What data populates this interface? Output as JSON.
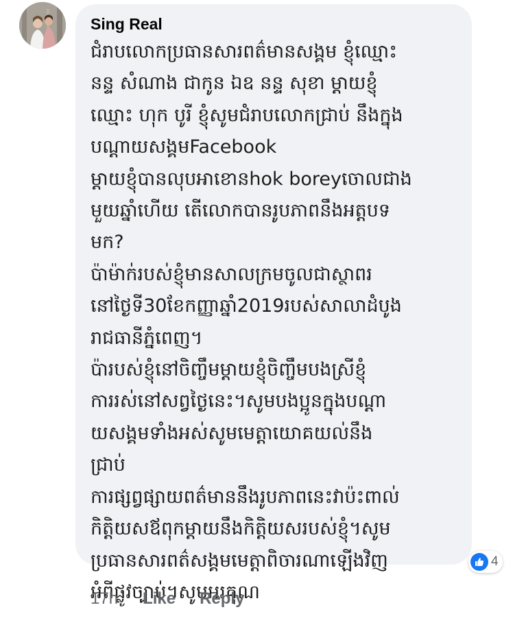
{
  "comment": {
    "author": "Sing Real",
    "lines": [
      "ជំរាបលោកប្រធានសារពត៌មានសង្គម ខ្ញុំឈ្មោះ",
      "នន្ទ សំណាង ជាកូន ឯឧ នន្ទ សុខា ម្តាយខ្ញុំ",
      "ឈ្មោះ ហុក បូរី ខ្ញុំសូមជំរាបលោកជ្រាប់ នឹងក្នុង",
      "បណ្តាយសង្គមFacebook",
      "ម្តាយខ្ញុំបានលុបអាខោនhok boreyចោលជាង",
      "មួយឆ្នាំហើយ តើលោកបានរូបភាពនឹងអត្តបទ",
      "មក?",
      "ប៉ាម៉ាក់របស់ខ្ញុំមានសាលក្រមចូលជាស្ថាពរ",
      "នៅថ្ងៃទី30ខែកញ្ញាឆ្នាំ2019របស់សាលាដំបូង",
      "រាជធានីភ្នំពេញ។",
      "ប៉ារបស់ខ្ញុំនៅចិញ្ចឹមម្តាយខ្ញុំចិញ្ចឹមបងស្រីខ្ញុំ",
      "ការរស់នៅសព្វថ្ងៃនេះ។សូមបងប្អូនក្នុងបណ្តា",
      "យសង្គមទាំងអស់សូមមេត្តាយោគយល់នឹង",
      "ជ្រាប់",
      "ការផ្សព្វផ្សាយពត៌មាននឹងរូបភាពនេះវាប៉ះពាល់",
      "កិត្តិយសឪពុកម្តាយនឹងកិត្តិយសរបស់ខ្ញុំ។សូម",
      "ប្រធានសារពត៌សង្គមមេត្តាពិចារណាឡើងវិញ",
      "អំពីផ្លូវច្បាប់។សូមអរគុណ"
    ],
    "reactions": {
      "icon": "like-thumb-icon",
      "count": "4",
      "color": "#1877f2"
    }
  },
  "actions": {
    "timestamp": "17h",
    "like_label": "Like",
    "reply_label": "Reply"
  },
  "colors": {
    "bubble_bg": "#f0f2f5",
    "meta_text": "#65676b",
    "author_text": "#050505"
  }
}
